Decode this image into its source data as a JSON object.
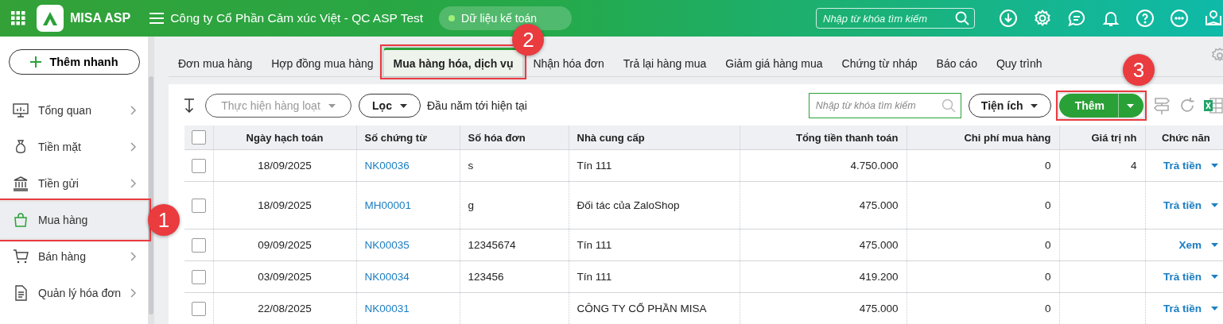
{
  "header": {
    "brand": "MISA ASP",
    "company": "Công ty Cổ Phần Cảm xúc Việt - QC ASP Test",
    "dataset": "Dữ liệu kế toán",
    "search": {
      "placeholder": "Nhập từ khóa tìm kiếm"
    }
  },
  "sidebar": {
    "quick_add": "Thêm nhanh",
    "items": [
      {
        "label": "Tổng quan",
        "selected": false
      },
      {
        "label": "Tiền mặt",
        "selected": false
      },
      {
        "label": "Tiền gửi",
        "selected": false
      },
      {
        "label": "Mua hàng",
        "selected": true,
        "callout": "1"
      },
      {
        "label": "Bán hàng",
        "selected": false
      },
      {
        "label": "Quản lý hóa đơn",
        "selected": false
      }
    ]
  },
  "tabs": [
    {
      "label": "Đơn mua hàng",
      "selected": false
    },
    {
      "label": "Hợp đồng mua hàng",
      "selected": false
    },
    {
      "label": "Mua hàng hóa, dịch vụ",
      "selected": true,
      "callout": "2"
    },
    {
      "label": "Nhận hóa đơn",
      "selected": false
    },
    {
      "label": "Trả lại hàng mua",
      "selected": false
    },
    {
      "label": "Giảm giá hàng mua",
      "selected": false
    },
    {
      "label": "Chứng từ nháp",
      "selected": false
    },
    {
      "label": "Báo cáo",
      "selected": false
    },
    {
      "label": "Quy trình",
      "selected": false
    }
  ],
  "toolbar": {
    "bulk_action": {
      "label": "Thực hiện hàng loạt",
      "disabled": true
    },
    "filter": "Lọc",
    "period": "Đầu năm tới hiện tại",
    "search": {
      "placeholder": "Nhập từ khóa tìm kiếm"
    },
    "utilities": "Tiện ích",
    "add": {
      "label": "Thêm",
      "callout": "3"
    }
  },
  "table": {
    "select_all_checked": false,
    "columns": [
      "Ngày hạch toán",
      "Số chứng từ",
      "Số hóa đơn",
      "Nhà cung cấp",
      "Tổng tiền thanh toán",
      "Chi phí mua hàng",
      "Giá trị nh",
      "Chức năn"
    ],
    "rows": [
      {
        "checked": false,
        "cells": [
          "18/09/2025",
          "NK00036",
          "s",
          "Tín 111",
          "4.750.000",
          "0",
          "4",
          "Trả tiền"
        ]
      },
      {
        "checked": false,
        "cells": [
          "18/09/2025",
          "MH00001",
          "g",
          "Đối tác của ZaloShop",
          "475.000",
          "0",
          "",
          "Trả tiền"
        ]
      },
      {
        "checked": false,
        "cells": [
          "09/09/2025",
          "NK00035",
          "12345674",
          "Tín 111",
          "475.000",
          "0",
          "",
          "Xem"
        ]
      },
      {
        "checked": false,
        "cells": [
          "03/09/2025",
          "NK00034",
          "123456",
          "Tín 111",
          "419.200",
          "0",
          "",
          "Trả tiền"
        ]
      },
      {
        "checked": false,
        "cells": [
          "22/08/2025",
          "NK00031",
          "",
          "CÔNG TY CỔ PHẦN MISA",
          "475.000",
          "0",
          "",
          "Trả tiền"
        ]
      }
    ]
  }
}
